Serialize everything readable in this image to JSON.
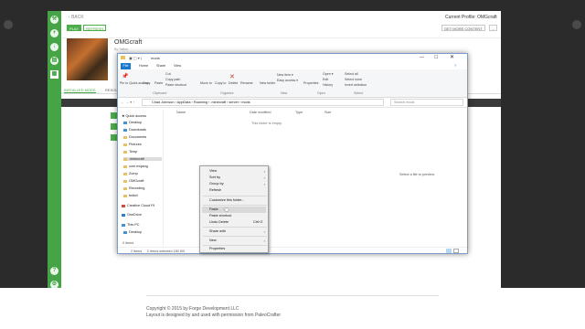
{
  "launcher": {
    "back_label": "BACK",
    "current_profile": "Current Profile: OMGcraft",
    "get_more_content": "GET MORE CONTENT",
    "more_button": "...",
    "profile_name": "OMGcraft",
    "profile_sub": "By Twitch",
    "play_label": "PLAY",
    "refresh_label": "REFRESH",
    "tabs": [
      "INSTALLED MODS",
      "RESOU"
    ],
    "footer_line1": "Copyright © 2015 by Forge Development LLC",
    "footer_line2": "Layout is designed by and used with permission from PaleoCrafter"
  },
  "explorer": {
    "title": "mods",
    "ribbon_tabs": [
      "File",
      "Home",
      "Share",
      "View"
    ],
    "ribbon_items": {
      "pin": "Pin to Quick access",
      "copy": "Copy",
      "paste": "Paste",
      "cut": "Cut",
      "copy_path": "Copy path",
      "paste_shortcut": "Paste shortcut",
      "move_to": "Move to",
      "copy_to": "Copy to",
      "delete": "Delete",
      "rename": "Rename",
      "new_folder": "New folder",
      "new_item": "New item ▾",
      "easy_access": "Easy access ▾",
      "properties": "Properties",
      "open": "Open ▾",
      "edit": "Edit",
      "history": "History",
      "select_all": "Select all",
      "select_none": "Select none",
      "invert_selection": "Invert selection"
    },
    "ribbon_groups": [
      "Clipboard",
      "Organize",
      "New",
      "Open",
      "Select"
    ],
    "address_path": [
      "Chad Johnson",
      "AppData",
      "Roaming",
      ".minecraft",
      "server",
      "mods"
    ],
    "search_placeholder": "Search mods",
    "columns": [
      "Name",
      "Date modified",
      "Type",
      "Size"
    ],
    "empty_text": "This folder is empty.",
    "preview_text": "Select a file to preview.",
    "nav": {
      "quick_access": "Quick access",
      "items": [
        "Desktop",
        "Downloads",
        "Documents",
        "Pictures",
        "Temp",
        ".minecraft",
        "com.mojang",
        "Zump",
        "OMGcraft",
        "Recording",
        "twitch"
      ],
      "creative_cloud": "Creative Cloud Fil",
      "onedrive": "OneDrive",
      "this_pc": "This PC",
      "desktop_pc": "Desktop"
    },
    "status_left_items": "0 items",
    "status_items": "2 items",
    "status_selected": "2 items selected 180 KB"
  },
  "context_menu": {
    "items": [
      {
        "label": "View",
        "sub": true
      },
      {
        "label": "Sort by",
        "sub": true
      },
      {
        "label": "Group by",
        "sub": true
      },
      {
        "label": "Refresh",
        "sub": false
      },
      {
        "label": "Customize this folder...",
        "sub": false
      },
      {
        "label": "Paste",
        "sub": false
      },
      {
        "label": "Paste shortcut",
        "sub": false
      },
      {
        "label": "Undo Delete",
        "shortcut": "Ctrl+Z"
      },
      {
        "label": "Share with",
        "sub": true
      },
      {
        "label": "New",
        "sub": true
      },
      {
        "label": "Properties",
        "sub": false
      }
    ]
  },
  "colors": {
    "accent_green": "#45a546",
    "explorer_blue": "#1979ca"
  }
}
